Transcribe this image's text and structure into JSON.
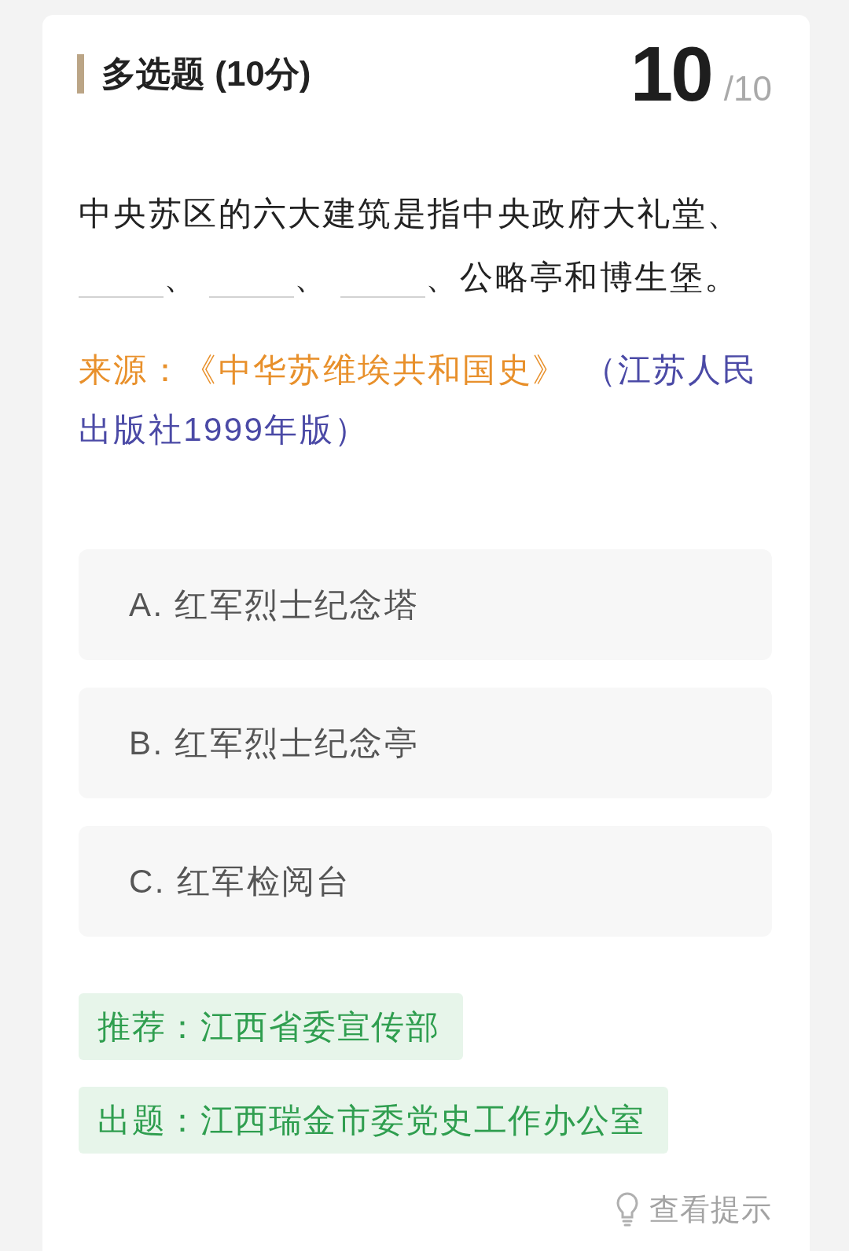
{
  "header": {
    "title": "多选题 (10分)",
    "score": "10",
    "max_score": "/10"
  },
  "question": [
    {
      "kind": "text",
      "text": "中央苏区的六大建筑是指中央政府大礼堂、"
    },
    {
      "kind": "blank"
    },
    {
      "kind": "text",
      "text": "、"
    },
    {
      "kind": "blank"
    },
    {
      "kind": "text",
      "text": "、"
    },
    {
      "kind": "blank"
    },
    {
      "kind": "text",
      "text": "、公略亭和博生堡。"
    }
  ],
  "source": {
    "label": "来源：",
    "title": "《中华苏维埃共和国史》",
    "publisher": "（江苏人民出版社1999年版）"
  },
  "options": [
    {
      "letter": "A.",
      "text": "红军烈士纪念塔",
      "selected": false
    },
    {
      "letter": "B.",
      "text": "红军烈士纪念亭",
      "selected": false
    },
    {
      "letter": "C.",
      "text": "红军检阅台",
      "selected": false
    }
  ],
  "credits": [
    {
      "label": "推荐：",
      "value": "江西省委宣传部"
    },
    {
      "label": "出题：",
      "value": "江西瑞金市委党史工作办公室"
    }
  ],
  "hint_link": {
    "label": "查看提示"
  }
}
